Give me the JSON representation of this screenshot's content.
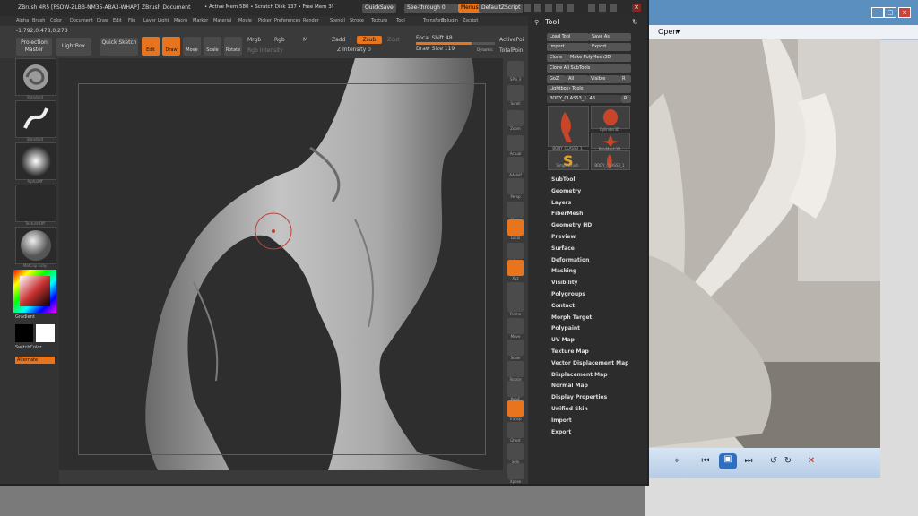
{
  "colors": {
    "accent": "#e8741e",
    "panel": "#2c2c2c",
    "canvas": "#2e2e2e"
  },
  "title": {
    "app": "ZBrush 4R5 [PSDW-ZLBB-NM35-ABA3-WHAP]",
    "doc": "ZBrush Document",
    "active_mem": "• Active Mem 580 • Scratch Disk 137 • Free Mem 3!",
    "quicksave": "QuickSave",
    "see_through": "See-through  0",
    "menus": "Menus",
    "default_script": "DefaultZScript"
  },
  "menu_items": [
    "Alpha",
    "Brush",
    "Color",
    "Document",
    "Draw",
    "Edit",
    "File",
    "Layer",
    "Light",
    "Macro",
    "Marker",
    "Material",
    "Movie",
    "Picker",
    "Preferences",
    "Render",
    "Stencil",
    "Stroke",
    "Texture",
    "Tool",
    "Transform",
    "Zplugin",
    "Zscript"
  ],
  "shelf": {
    "coords": "-1.792,0.478,0.278",
    "projection_master": "Projection Master",
    "lightbox": "LightBox",
    "quick_sketch": "Quick Sketch",
    "edit": "Edit",
    "draw": "Draw",
    "move": "Move",
    "scale": "Scale",
    "rotate": "Rotate",
    "mrgb": "Mrgb",
    "rgb": "Rgb",
    "m": "M",
    "rgb_intensity": "Rgb Intensity",
    "zadd": "Zadd",
    "zsub": "Zsub",
    "zcut": "Zcut",
    "z_intensity": "Z Intensity 0",
    "focal_shift": "Focal Shift  48",
    "draw_size": "Draw Size  119",
    "dynamic": "Dynamic",
    "active_points": "ActivePoi",
    "total_points": "TotalPoin"
  },
  "left_tray": {
    "thumb_labels": [
      "Standard",
      "Standard",
      "AlphaOff",
      "Texture Off",
      "MatCap Gray"
    ],
    "gradient": "Gradient",
    "switchcolor": "SwitchColor",
    "alternate": "Alternate"
  },
  "right_shelf": [
    "SPix 3",
    "Scroll",
    "Zoom",
    "Actual",
    "AAHalf",
    "Persp",
    "Floor",
    "Local",
    "L.Sym",
    "Xyz",
    "",
    "Frame",
    "Move",
    "Scale",
    "Rotate",
    "PolyF",
    "Transp",
    "Ghost",
    "Solo",
    "Xpose"
  ],
  "tool": {
    "title": "Tool",
    "load_tool": "Load Tool",
    "save_as": "Save As",
    "import": "Import",
    "export": "Export",
    "clone": "Clone",
    "make_polymesh": "Make PolyMesh3D",
    "clone_all": "Clone All SubTools",
    "goz": "GoZ",
    "all": "All",
    "visible": "Visible",
    "r": "R",
    "lightbox_tools": "Lightbox› Tools",
    "current": "BODY_CLASS3_1. 48",
    "tiles": [
      "BODY_CLASS3_1",
      "Cylinder3D",
      "PolyMesh3D",
      "SimpleBrush",
      "BODY_CLASS3_1"
    ],
    "items": [
      "SubTool",
      "Geometry",
      "Layers",
      "FiberMesh",
      "Geometry HD",
      "Preview",
      "Surface",
      "Deformation",
      "Masking",
      "Visibility",
      "Polygroups",
      "Contact",
      "Morph Target",
      "Polypaint",
      "UV Map",
      "Texture Map",
      "Vector Displacement Map",
      "Displacement Map",
      "Normal Map",
      "Display Properties",
      "Unified Skin",
      "Import",
      "Export"
    ]
  },
  "viewer": {
    "open": "Open"
  }
}
